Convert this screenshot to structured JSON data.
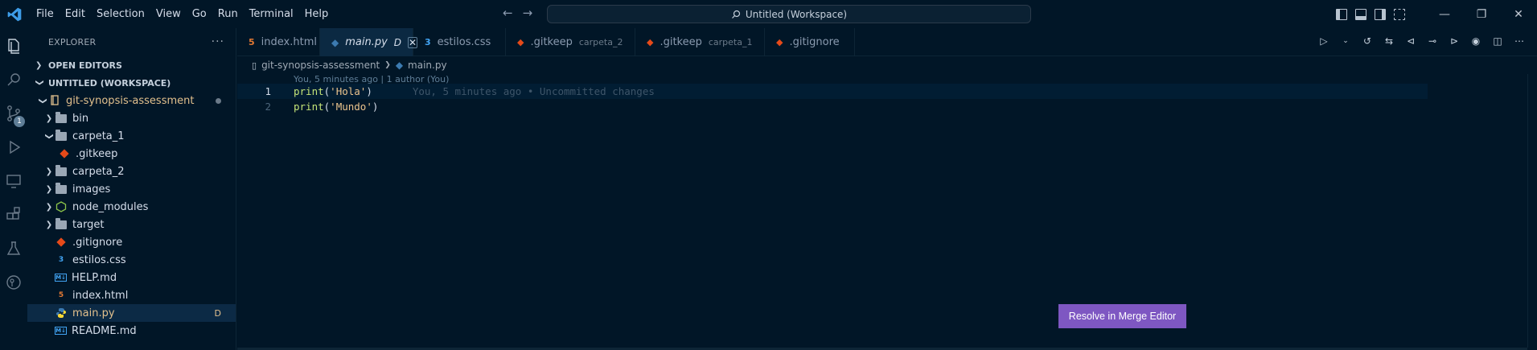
{
  "menu": [
    "File",
    "Edit",
    "Selection",
    "View",
    "Go",
    "Run",
    "Terminal",
    "Help"
  ],
  "command_center": {
    "text": "Untitled (Workspace)"
  },
  "sidebar": {
    "title": "EXPLORER",
    "open_editors": "OPEN EDITORS",
    "workspace": "UNTITLED (WORKSPACE)",
    "root": "git-synopsis-assessment",
    "items": [
      {
        "label": "bin"
      },
      {
        "label": "carpeta_1"
      },
      {
        "label": ".gitkeep"
      },
      {
        "label": "carpeta_2"
      },
      {
        "label": "images"
      },
      {
        "label": "node_modules"
      },
      {
        "label": "target"
      },
      {
        "label": ".gitignore"
      },
      {
        "label": "estilos.css"
      },
      {
        "label": "HELP.md"
      },
      {
        "label": "index.html"
      },
      {
        "label": "main.py",
        "badge": "D"
      },
      {
        "label": "README.md"
      }
    ]
  },
  "scm_badge": "1",
  "tabs": [
    {
      "label": "index.html"
    },
    {
      "label": "main.py",
      "mod": "D"
    },
    {
      "label": "estilos.css"
    },
    {
      "label": ".gitkeep",
      "desc": "carpeta_2"
    },
    {
      "label": ".gitkeep",
      "desc": "carpeta_1"
    },
    {
      "label": ".gitignore"
    }
  ],
  "breadcrumb": {
    "folder": "git-synopsis-assessment",
    "file": "main.py"
  },
  "blame": "You, 5 minutes ago | 1 author (You)",
  "code": {
    "lines": [
      {
        "num": "1",
        "fn": "print",
        "arg": "'Hola'"
      },
      {
        "num": "2",
        "fn": "print",
        "arg": "'Mundo'"
      }
    ],
    "ghost": "You, 5 minutes ago • Uncommitted changes"
  },
  "merge_button": "Resolve in Merge Editor",
  "colors": {
    "bg": "#011627",
    "accent": "#7e57c2",
    "html": "#e37933",
    "css": "#42a5f5",
    "git": "#e64a19",
    "python": "#3c7ab0"
  }
}
